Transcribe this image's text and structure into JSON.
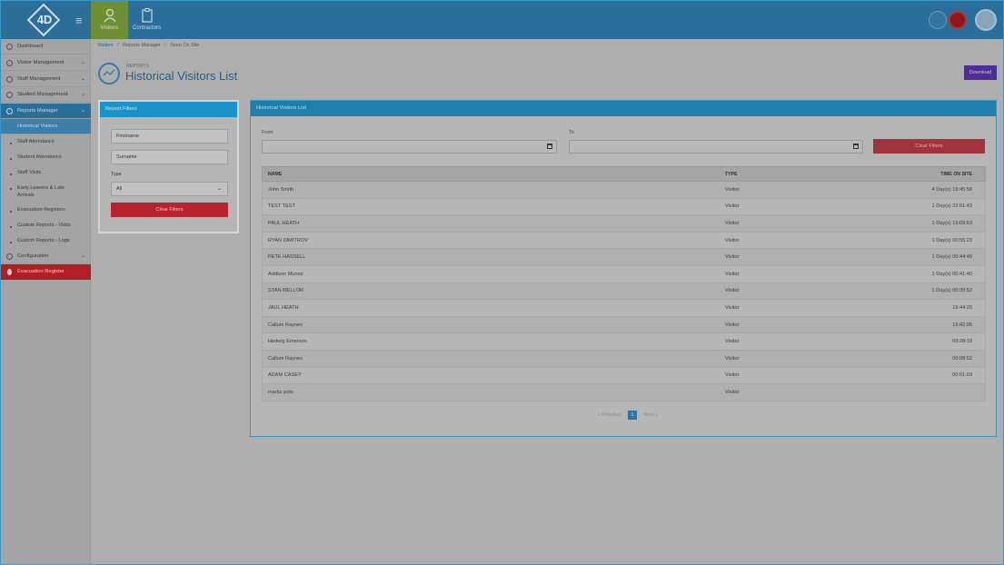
{
  "topbar": {
    "logo": "4D",
    "tabs": [
      {
        "label": "Visitors",
        "icon": "user-icon"
      },
      {
        "label": "Contractors",
        "icon": "clipboard-icon"
      }
    ]
  },
  "sidebar": {
    "items": [
      {
        "label": "Dashboard",
        "icon": "dashboard-icon",
        "chevron": false
      },
      {
        "label": "Visitor Management",
        "icon": "user-icon",
        "chevron": true
      },
      {
        "label": "Staff Management",
        "icon": "id-card-icon",
        "chevron": true
      },
      {
        "label": "Student Management",
        "icon": "student-icon",
        "chevron": true
      },
      {
        "label": "Reports Manager",
        "icon": "reports-icon",
        "chevron": true
      }
    ],
    "sub_items": [
      "Historical Visitors",
      "Staff Attendance",
      "Student Attendance",
      "Staff Visits",
      "Early Leavers & Late Arrivals",
      "Evacuation Registers",
      "Custom Reports - Visits",
      "Custom Reports - Logs"
    ],
    "configuration": "Configuration",
    "evacuation": "Evacuation Register"
  },
  "breadcrumb": {
    "root": "Visitors",
    "middle": "Reports Manager",
    "current": "Seen On Site"
  },
  "page": {
    "kicker": "REPORTS",
    "title": "Historical Visitors List",
    "download": "Download"
  },
  "filters": {
    "title": "Report Filters",
    "firstname": "Firstname",
    "surname": "Surname",
    "type_label": "Type",
    "type_value": "All",
    "clear": "Clear Filters"
  },
  "list": {
    "title": "Historical Visitors List",
    "from_label": "From",
    "to_label": "To",
    "clear": "Clear Filters",
    "columns": {
      "name": "NAME",
      "type": "TYPE",
      "time": "TIME ON SITE"
    },
    "rows": [
      {
        "name": "John Smith",
        "type": "Visitor",
        "time": "4 Day(s) 19:45:58"
      },
      {
        "name": "TEST TEST",
        "type": "Visitor",
        "time": "1 Day(s) 22:51:43"
      },
      {
        "name": "PAUL HEATH",
        "type": "Visitor",
        "time": "1 Day(s) 19:09:53"
      },
      {
        "name": "RYAN DIMITROV",
        "type": "Visitor",
        "time": "1 Day(s) 00:55:23"
      },
      {
        "name": "PETE HASSELL",
        "type": "Visitor",
        "time": "1 Day(s) 00:44:49"
      },
      {
        "name": "Addison Munoz",
        "type": "Visitor",
        "time": "1 Day(s) 00:41:40"
      },
      {
        "name": "STAN MELLOR",
        "type": "Visitor",
        "time": "1 Day(s) 00:39:52"
      },
      {
        "name": "JAUL HEATH",
        "type": "Visitor",
        "time": "19:44:20"
      },
      {
        "name": "Callum Raynes",
        "type": "Visitor",
        "time": "19:42:06"
      },
      {
        "name": "Hedwig Emerson",
        "type": "Visitor",
        "time": "03:28:19"
      },
      {
        "name": "Callum Raynes",
        "type": "Visitor",
        "time": "00:08:52"
      },
      {
        "name": "ADAM CASEY",
        "type": "Visitor",
        "time": "00:01:03"
      },
      {
        "name": "marko polo",
        "type": "Visitor",
        "time": ""
      }
    ],
    "pagination": {
      "previous": "Previous",
      "page": "1",
      "next": "Next"
    }
  }
}
